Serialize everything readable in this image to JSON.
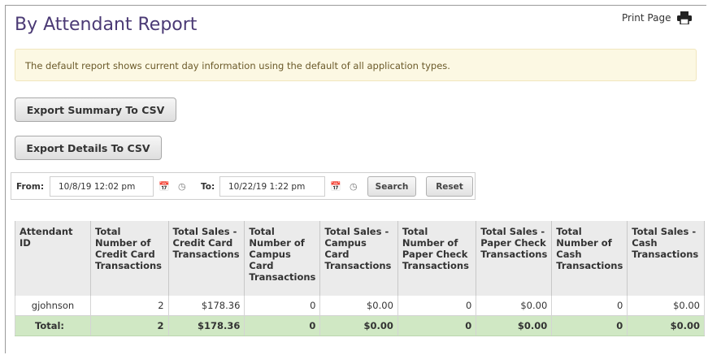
{
  "page": {
    "title": "By Attendant Report",
    "print_label": "Print Page"
  },
  "alert": {
    "text": "The default report shows current day information using the default of all application types."
  },
  "buttons": {
    "export_summary": "Export Summary To CSV",
    "export_details": "Export Details To CSV"
  },
  "filters": {
    "from_label": "From:",
    "from_value": "10/8/19 12:02 pm",
    "to_label": "To:",
    "to_value": "10/22/19 1:22 pm",
    "search_label": "Search",
    "reset_label": "Reset"
  },
  "table": {
    "headers": [
      "Attendant ID",
      "Total Number of Credit Card Transactions",
      "Total Sales - Credit Card Transactions",
      "Total Number of Campus Card Transactions",
      "Total Sales - Campus Card Transactions",
      "Total Number of Paper Check Transactions",
      "Total Sales - Paper Check Transactions",
      "Total Number of Cash Transactions",
      "Total Sales - Cash Transactions"
    ],
    "rows": [
      [
        "gjohnson",
        "2",
        "$178.36",
        "0",
        "$0.00",
        "0",
        "$0.00",
        "0",
        "$0.00"
      ]
    ],
    "total": [
      "Total:",
      "2",
      "$178.36",
      "0",
      "$0.00",
      "0",
      "$0.00",
      "0",
      "$0.00"
    ]
  },
  "icons": {
    "print": "printer-icon",
    "calendar": "calendar-icon",
    "clock": "clock-icon"
  }
}
